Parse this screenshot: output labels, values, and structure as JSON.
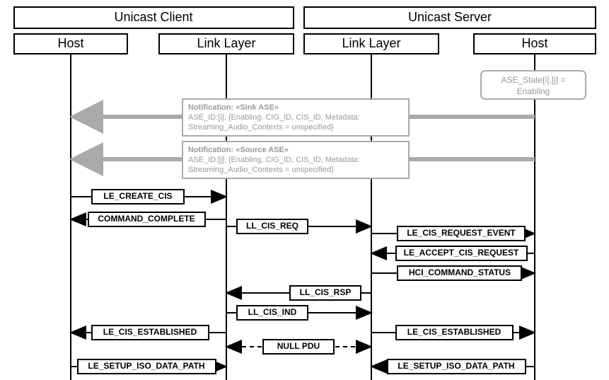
{
  "actors": {
    "client": "Unicast Client",
    "server": "Unicast Server",
    "host_l": "Host",
    "link_l": "Link Layer",
    "link_r": "Link Layer",
    "host_r": "Host"
  },
  "state_note": {
    "line1": "ASE_State[i],[j] =",
    "line2": "Enabling"
  },
  "note_sink": {
    "title": "Notification: «Sink ASE»",
    "l1": "ASE_ID:[i], {Enabling, CIG_ID, CIS_ID, Metadata:",
    "l2": "Streaming_Audio_Contexts = unspecified}"
  },
  "note_source": {
    "title": "Notification: «Source ASE»",
    "l1": "ASE_ID:[j], {Enabling, CIG_ID, CIS_ID, Metadata:",
    "l2": "Streaming_Audio_Contexts = unspecified}"
  },
  "msgs": {
    "m1": "LE_CREATE_CIS",
    "m2": "COMMAND_COMPLETE",
    "m3": "LL_CIS_REQ",
    "m4": "LE_CIS_REQUEST_EVENT",
    "m5": "LE_ACCEPT_CIS_REQUEST",
    "m6": "HCI_COMMAND_STATUS",
    "m7": "LL_CIS_RSP",
    "m8": "LL_CIS_IND",
    "m9a": "LE_CIS_ESTABLISHED",
    "m9b": "LE_CIS_ESTABLISHED",
    "m10": "NULL PDU",
    "m11a": "LE_SETUP_ISO_DATA_PATH",
    "m11b": "LE_SETUP_ISO_DATA_PATH"
  }
}
